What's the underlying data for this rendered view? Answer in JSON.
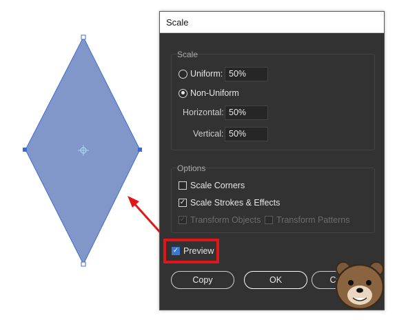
{
  "dialog": {
    "title": "Scale"
  },
  "scale_group": {
    "title": "Scale",
    "uniform": {
      "label": "Uniform:",
      "value": "50%",
      "selected": false
    },
    "non_uniform": {
      "label": "Non-Uniform",
      "selected": true
    },
    "horizontal": {
      "label": "Horizontal:",
      "value": "50%"
    },
    "vertical": {
      "label": "Vertical:",
      "value": "50%"
    }
  },
  "options_group": {
    "title": "Options",
    "scale_corners": {
      "label": "Scale Corners",
      "checked": false
    },
    "scale_strokes": {
      "label": "Scale Strokes & Effects",
      "checked": true
    },
    "transform_objects": {
      "label": "Transform Objects",
      "checked": true,
      "enabled": false
    },
    "transform_patterns": {
      "label": "Transform Patterns",
      "checked": false,
      "enabled": false
    }
  },
  "preview": {
    "label": "Preview",
    "checked": true
  },
  "buttons": {
    "copy": "Copy",
    "ok": "OK",
    "cancel": "Cancel"
  },
  "colors": {
    "shape_fill": "#8197c9",
    "shape_stroke": "#3d6bd1",
    "dialog_bg": "#323232",
    "highlight": "#e4141a"
  },
  "icons": {
    "check": "✓"
  }
}
